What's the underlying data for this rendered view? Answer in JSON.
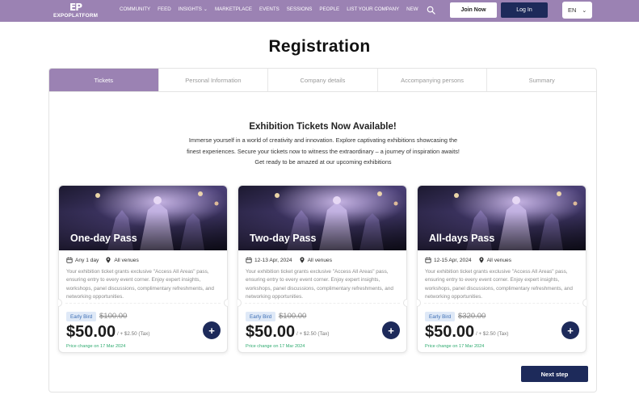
{
  "header": {
    "logo_mark": "EP",
    "logo_text": "EXPOPLATFORM",
    "nav": [
      {
        "label": "COMMUNITY"
      },
      {
        "label": "FEED"
      },
      {
        "label": "INSIGHTS"
      },
      {
        "label": "MARKETPLACE"
      },
      {
        "label": "EVENTS"
      },
      {
        "label": "SESSIONS"
      },
      {
        "label": "PEOPLE"
      },
      {
        "label": "LIST YOUR COMPANY"
      },
      {
        "label": "NEW"
      }
    ],
    "join_label": "Join Now",
    "login_label": "Log In",
    "language": "EN"
  },
  "page_title": "Registration",
  "tabs": [
    {
      "label": "Tickets",
      "active": true
    },
    {
      "label": "Personal Information",
      "active": false
    },
    {
      "label": "Company details",
      "active": false
    },
    {
      "label": "Accompanying persons",
      "active": false
    },
    {
      "label": "Summary",
      "active": false
    }
  ],
  "headline": "Exhibition Tickets Now Available!",
  "intro": "Immerse yourself in a world of creativity and innovation. Explore captivating exhibitions showcasing the finest experiences. Secure your tickets now to witness the extraordinary – a journey of inspiration awaits! Get ready to be amazed at our upcoming exhibitions",
  "tickets": [
    {
      "name": "One-day Pass",
      "date": "Any 1 day",
      "venue": "All venues",
      "description": "Your exhibition ticket grants exclusive \"Access All Areas\" pass, ensuring entry to every event corner. Enjoy expert insights, workshops, panel discussions, complimentary refreshments, and networking opportunities.",
      "badge": "Early Bird",
      "old_price": "$100.00",
      "price": "$50.00",
      "tax": "/ + $2.50 (Tax)",
      "price_change": "Price change on 17 Mar 2024"
    },
    {
      "name": "Two-day Pass",
      "date": "12-13 Apr, 2024",
      "venue": "All venues",
      "description": "Your exhibition ticket grants exclusive \"Access All Areas\" pass, ensuring entry to every event corner. Enjoy expert insights, workshops, panel discussions, complimentary refreshments, and networking opportunities.",
      "badge": "Early Bird",
      "old_price": "$100.00",
      "price": "$50.00",
      "tax": "/ + $2.50 (Tax)",
      "price_change": "Price change on 17 Mar 2024"
    },
    {
      "name": "All-days Pass",
      "date": "12-15 Apr, 2024",
      "venue": "All venues",
      "description": "Your exhibition ticket grants exclusive \"Access All Areas\" pass, ensuring entry to every event corner. Enjoy expert insights, workshops, panel discussions, complimentary refreshments, and networking opportunities.",
      "badge": "Early Bird",
      "old_price": "$320.00",
      "price": "$50.00",
      "tax": "/ + $2.50 (Tax)",
      "price_change": "Price change on 17 Mar 2024"
    }
  ],
  "next_label": "Next step",
  "icons": {
    "search": "search-icon",
    "calendar": "calendar-icon",
    "location": "location-pin-icon",
    "add": "plus-icon",
    "chevron": "chevron-down-icon"
  },
  "colors": {
    "brand": "#9b82b3",
    "primary_button": "#1d2a5a",
    "badge_bg": "#dfe9f7",
    "badge_text": "#3d6fb5",
    "price_change": "#2eaa6f"
  }
}
